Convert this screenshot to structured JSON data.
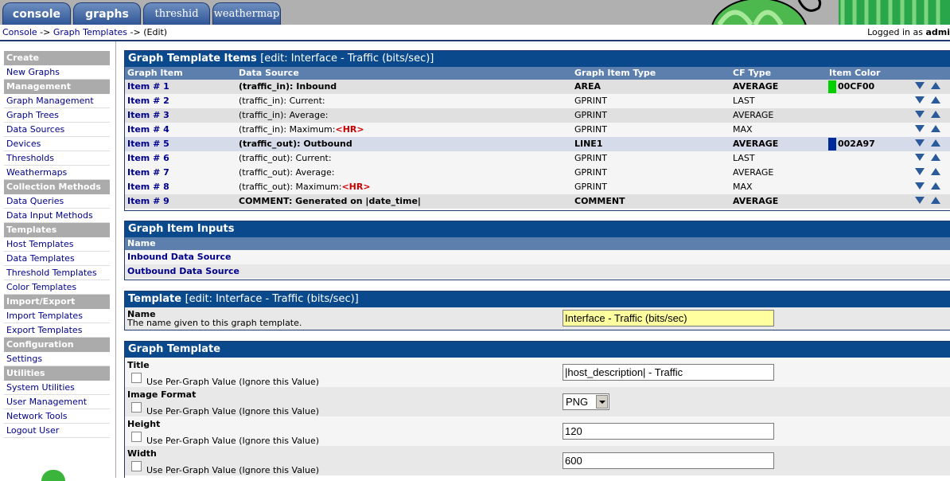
{
  "tabs": [
    "console",
    "graphs",
    "threshid",
    "weathermap"
  ],
  "breadcrumb": {
    "console": "Console",
    "sep1": " -> ",
    "templates": "Graph Templates",
    "sep2": " -> ",
    "edit": "(Edit)"
  },
  "login": {
    "prefix": "Logged in as ",
    "user": "admi"
  },
  "sidebar": [
    {
      "type": "header",
      "label": "Create"
    },
    {
      "type": "item",
      "label": "New Graphs"
    },
    {
      "type": "header",
      "label": "Management"
    },
    {
      "type": "item",
      "label": "Graph Management"
    },
    {
      "type": "item",
      "label": "Graph Trees"
    },
    {
      "type": "item",
      "label": "Data Sources"
    },
    {
      "type": "item",
      "label": "Devices"
    },
    {
      "type": "item",
      "label": "Thresholds"
    },
    {
      "type": "item",
      "label": "Weathermaps"
    },
    {
      "type": "header",
      "label": "Collection Methods"
    },
    {
      "type": "item",
      "label": "Data Queries"
    },
    {
      "type": "item",
      "label": "Data Input Methods"
    },
    {
      "type": "header",
      "label": "Templates"
    },
    {
      "type": "item",
      "label": "Graph Templates",
      "selected": true
    },
    {
      "type": "item",
      "label": "Host Templates"
    },
    {
      "type": "item",
      "label": "Data Templates"
    },
    {
      "type": "item",
      "label": "Threshold Templates"
    },
    {
      "type": "item",
      "label": "Color Templates"
    },
    {
      "type": "header",
      "label": "Import/Export"
    },
    {
      "type": "item",
      "label": "Import Templates"
    },
    {
      "type": "item",
      "label": "Export Templates"
    },
    {
      "type": "header",
      "label": "Configuration"
    },
    {
      "type": "item",
      "label": "Settings"
    },
    {
      "type": "header",
      "label": "Utilities"
    },
    {
      "type": "item",
      "label": "System Utilities"
    },
    {
      "type": "item",
      "label": "User Management"
    },
    {
      "type": "item",
      "label": "Network Tools"
    },
    {
      "type": "item",
      "label": "Logout User"
    }
  ],
  "items_panel": {
    "title": "Graph Template Items",
    "subtitle": "[edit: Interface - Traffic (bits/sec)]",
    "columns": [
      "Graph Item",
      "Data Source",
      "Graph Item Type",
      "CF Type",
      "Item Color"
    ],
    "rows": [
      {
        "item": "Item # 1",
        "ds": "(traffic_in): Inbound",
        "hr": "",
        "type": "AREA",
        "cf": "AVERAGE",
        "color": "00CF00",
        "hex": "#00CF00",
        "bold": true
      },
      {
        "item": "Item # 2",
        "ds": "(traffic_in): Current:",
        "hr": "",
        "type": "GPRINT",
        "cf": "LAST",
        "color": "",
        "hex": "",
        "bold": false
      },
      {
        "item": "Item # 3",
        "ds": "(traffic_in): Average:",
        "hr": "",
        "type": "GPRINT",
        "cf": "AVERAGE",
        "color": "",
        "hex": "",
        "bold": false
      },
      {
        "item": "Item # 4",
        "ds": "(traffic_in): Maximum:",
        "hr": "<HR>",
        "type": "GPRINT",
        "cf": "MAX",
        "color": "",
        "hex": "",
        "bold": false
      },
      {
        "item": "Item # 5",
        "ds": "(traffic_out): Outbound",
        "hr": "",
        "type": "LINE1",
        "cf": "AVERAGE",
        "color": "002A97",
        "hex": "#002A97",
        "bold": true
      },
      {
        "item": "Item # 6",
        "ds": "(traffic_out): Current:",
        "hr": "",
        "type": "GPRINT",
        "cf": "LAST",
        "color": "",
        "hex": "",
        "bold": false
      },
      {
        "item": "Item # 7",
        "ds": "(traffic_out): Average:",
        "hr": "",
        "type": "GPRINT",
        "cf": "AVERAGE",
        "color": "",
        "hex": "",
        "bold": false
      },
      {
        "item": "Item # 8",
        "ds": "(traffic_out): Maximum:",
        "hr": "<HR>",
        "type": "GPRINT",
        "cf": "MAX",
        "color": "",
        "hex": "",
        "bold": false
      },
      {
        "item": "Item # 9",
        "ds": "COMMENT: Generated on |date_time|",
        "hr": "",
        "type": "COMMENT",
        "cf": "AVERAGE",
        "color": "",
        "hex": "",
        "bold": true
      }
    ]
  },
  "inputs_panel": {
    "title": "Graph Item Inputs",
    "column": "Name",
    "rows": [
      "Inbound Data Source",
      "Outbound Data Source"
    ]
  },
  "template_panel": {
    "title": "Template",
    "subtitle": "[edit: Interface - Traffic (bits/sec)]",
    "name_label": "Name",
    "name_desc": "The name given to this graph template.",
    "name_value": "Interface - Traffic (bits/sec)"
  },
  "graph_panel": {
    "title": "Graph Template",
    "per_graph": "Use Per-Graph Value (Ignore this Value)",
    "fields": [
      {
        "label": "Title",
        "value": "|host_description| - Traffic",
        "kind": "text"
      },
      {
        "label": "Image Format",
        "value": "PNG",
        "kind": "select"
      },
      {
        "label": "Height",
        "value": "120",
        "kind": "text"
      },
      {
        "label": "Width",
        "value": "600",
        "kind": "text"
      }
    ]
  }
}
